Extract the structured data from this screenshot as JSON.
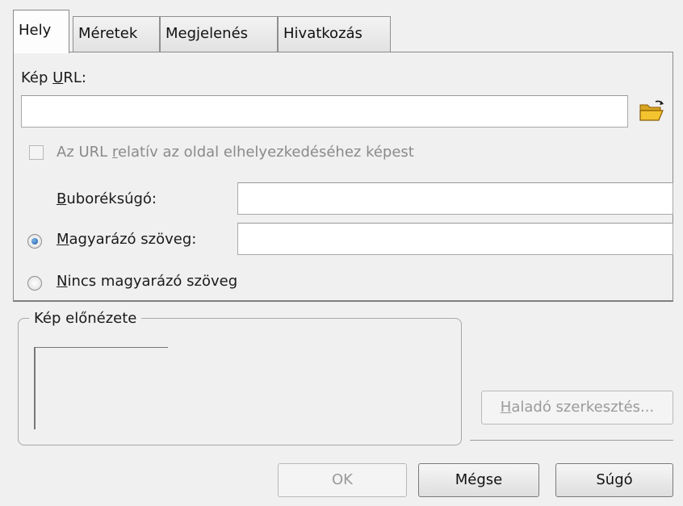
{
  "tabs": [
    {
      "label": "Hely",
      "active": true
    },
    {
      "label": "Méretek",
      "active": false
    },
    {
      "label": "Megjelenés",
      "active": false
    },
    {
      "label": "Hivatkozás",
      "active": false
    }
  ],
  "location": {
    "url_label_pre": "Kép ",
    "url_label_u": "U",
    "url_label_post": "RL:",
    "url_value": "",
    "browse_icon": "folder-open-icon",
    "relative": {
      "pre": "Az URL ",
      "u": "r",
      "post": "elatív az oldal elhelyezkedéséhez képest",
      "checked": false,
      "enabled": false
    },
    "tooltip": {
      "u": "B",
      "post": "uboréksúgó:",
      "value": ""
    },
    "alt_text": {
      "u": "M",
      "post": "agyarázó szöveg:",
      "value": "",
      "selected": true
    },
    "no_alt": {
      "u": "N",
      "post": "incs magyarázó szöveg",
      "selected": false
    }
  },
  "preview": {
    "title": "Kép előnézete"
  },
  "advanced_edit": {
    "u": "H",
    "post": "aladó szerkesztés..."
  },
  "buttons": {
    "ok": "OK",
    "cancel": "Mégse",
    "help": "Súgó"
  },
  "colors": {
    "radio_dot": "#1e5aa8",
    "disabled_text": "#8a8a8a"
  }
}
